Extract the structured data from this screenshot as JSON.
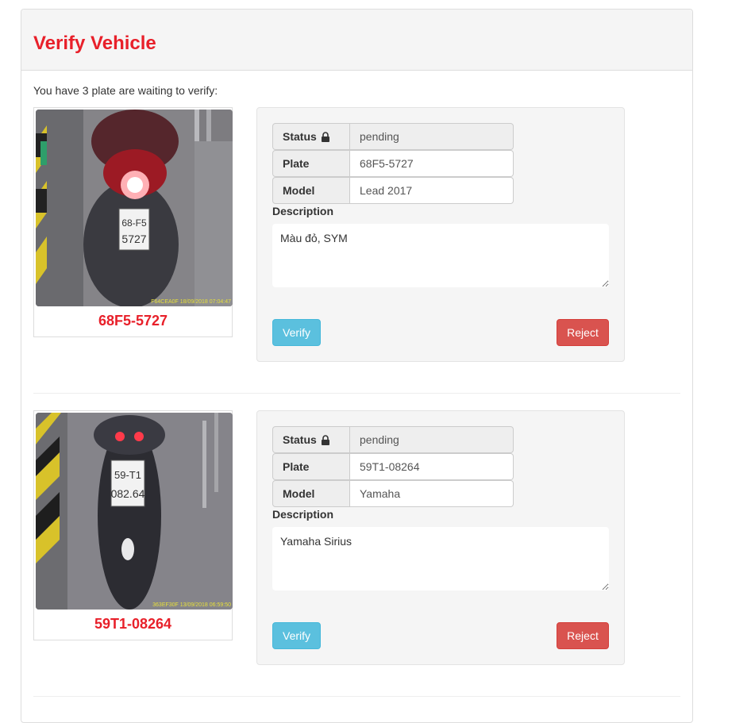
{
  "panel": {
    "title": "Verify Vehicle"
  },
  "intro_text": "You have 3 plate are waiting to verify:",
  "labels": {
    "status": "Status",
    "plate": "Plate",
    "model": "Model",
    "description": "Description",
    "verify": "Verify",
    "reject": "Reject"
  },
  "vehicles": [
    {
      "plate": "68F5-5727",
      "status": "pending",
      "model": "Lead 2017",
      "description": "Màu đỏ, SYM",
      "photo_plate_lines": [
        "68-F5",
        "5727"
      ],
      "photo_stamp": "F64CEA0F  18/09/2018 07:04:47"
    },
    {
      "plate": "59T1-08264",
      "status": "pending",
      "model": "Yamaha",
      "description": "Yamaha Sirius",
      "photo_plate_lines": [
        "59-T1",
        "082.64"
      ],
      "photo_stamp": "363EF30F  13/09/2018 06:59:50"
    }
  ],
  "icons": {
    "status_lock": "lock-icon"
  },
  "colors": {
    "title_red": "#e8202a",
    "verify_button": "#5bc0de",
    "reject_button": "#d9534f"
  }
}
